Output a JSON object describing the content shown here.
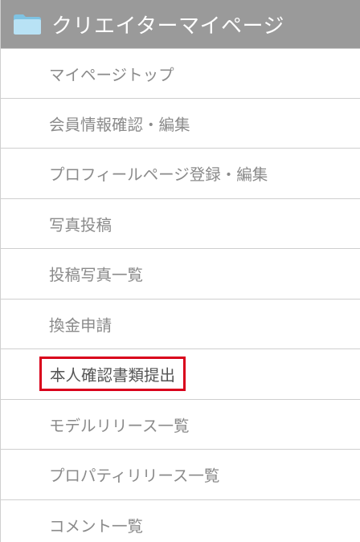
{
  "header": {
    "title": "クリエイターマイページ",
    "icon": "folder-icon",
    "background_color": "#9a9a9a",
    "icon_color": "#a7d8ef"
  },
  "menu": {
    "items": [
      {
        "label": "マイページトップ"
      },
      {
        "label": "会員情報確認・編集"
      },
      {
        "label": "プロフィールページ登録・編集"
      },
      {
        "label": "写真投稿"
      },
      {
        "label": "投稿写真一覧"
      },
      {
        "label": "換金申請"
      },
      {
        "label": "本人確認書類提出",
        "highlighted": true,
        "highlight_color": "#d9001b"
      },
      {
        "label": "モデルリリース一覧"
      },
      {
        "label": "プロパティリリース一覧"
      },
      {
        "label": "コメント一覧"
      }
    ]
  }
}
